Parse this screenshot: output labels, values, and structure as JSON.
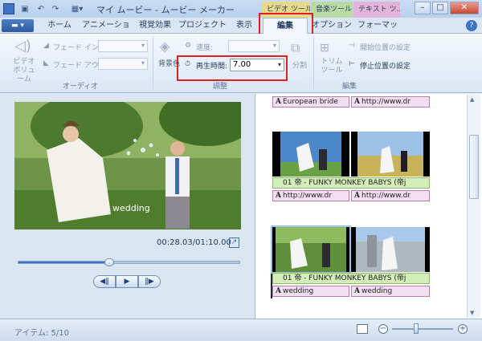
{
  "window": {
    "title": "マイ ムービー - ムービー メーカー",
    "context_tabs": [
      "ビデオ ツール",
      "音楽ツール",
      "テキスト ツ..."
    ],
    "controls": {
      "minimize": "–",
      "maximize": "□",
      "close": "✕"
    }
  },
  "qat": {
    "icons": [
      "save-icon",
      "undo-icon",
      "redo-icon"
    ]
  },
  "tabs": {
    "app_button": "▬ ▾",
    "items": [
      {
        "label": "ホーム"
      },
      {
        "label": "アニメーション"
      },
      {
        "label": "視覚効果"
      },
      {
        "label": "プロジェクト"
      },
      {
        "label": "表示"
      },
      {
        "label": "編集"
      },
      {
        "label": "オプション"
      },
      {
        "label": "フォーマット"
      }
    ],
    "active": "編集",
    "help": "?"
  },
  "ribbon": {
    "audio": {
      "video_volume": "ビデオ\nボリューム",
      "fade_in": "フェード イン:",
      "fade_out": "フェード アウト:",
      "group_label": "オーディオ"
    },
    "adjust": {
      "bg_color": "背景色",
      "speed": "速度:",
      "duration_label": "再生時間:",
      "duration_value": "7.00",
      "split": "分割",
      "trim": "トリム\nツール",
      "group_label": "調整"
    },
    "edit": {
      "set_start": "開始位置の設定",
      "set_end": "停止位置の設定",
      "group_label": "編集"
    }
  },
  "preview": {
    "overlay_text": "wedding",
    "timecode": "00:28.03/01:10.00",
    "seek_fraction": 0.41,
    "controls": {
      "prev": "◀‖",
      "play": "▶",
      "next": "‖▶"
    }
  },
  "storyboard": {
    "row1_captions": [
      "European bride",
      "http://www.dr"
    ],
    "row2_title": "01 帝 - FUNKY MONKEY BABYS (帝j",
    "row2_captions": [
      "http://www.dr",
      "http://www.dr"
    ],
    "row3_title": "01 帝 - FUNKY MONKEY BABYS (帝j",
    "row3_captions": [
      "wedding",
      "wedding"
    ]
  },
  "status": {
    "items": "アイテム: 5/10",
    "zoom_minus": "−",
    "zoom_plus": "+",
    "zoom_fraction": 0.4
  },
  "colors": {
    "highlight": "#e02020",
    "ribbon_accent": "#3d73c0"
  }
}
